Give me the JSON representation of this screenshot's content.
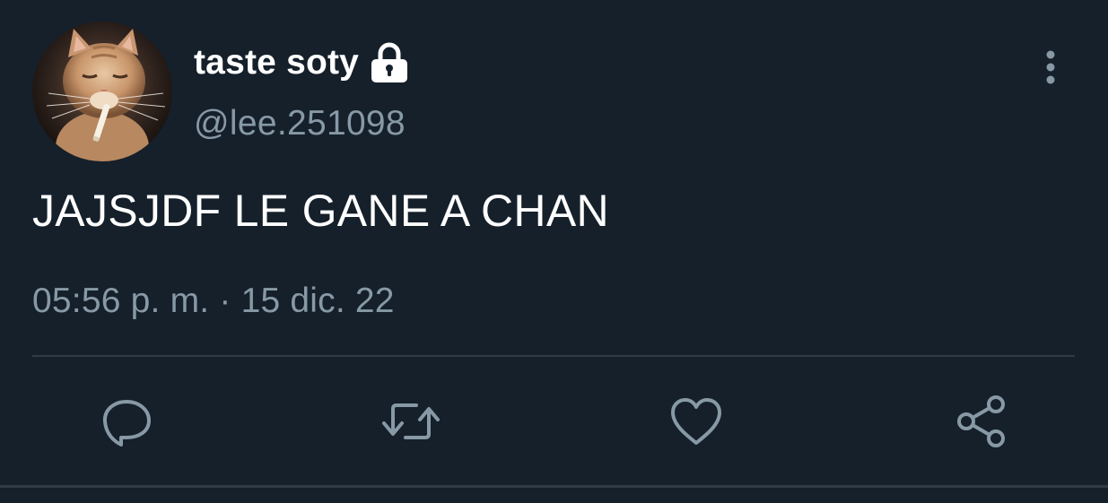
{
  "user": {
    "display_name": "taste soty",
    "handle": "@lee.251098",
    "protected_icon": "lock-icon",
    "avatar": "avatar-cat-photo"
  },
  "tweet": {
    "text": "JAJSJDF LE GANE A CHAN",
    "timestamp": "05:56 p. m. · 15 dic. 22"
  },
  "actions": [
    {
      "name": "reply",
      "icon": "reply-icon"
    },
    {
      "name": "retweet",
      "icon": "retweet-icon"
    },
    {
      "name": "like",
      "icon": "heart-icon"
    },
    {
      "name": "share",
      "icon": "share-icon"
    }
  ],
  "menu": {
    "icon": "more-vertical-icon"
  },
  "colors": {
    "background": "#15202b",
    "text_primary": "#ffffff",
    "text_secondary": "#8899a6",
    "divider": "#2f3b47"
  }
}
